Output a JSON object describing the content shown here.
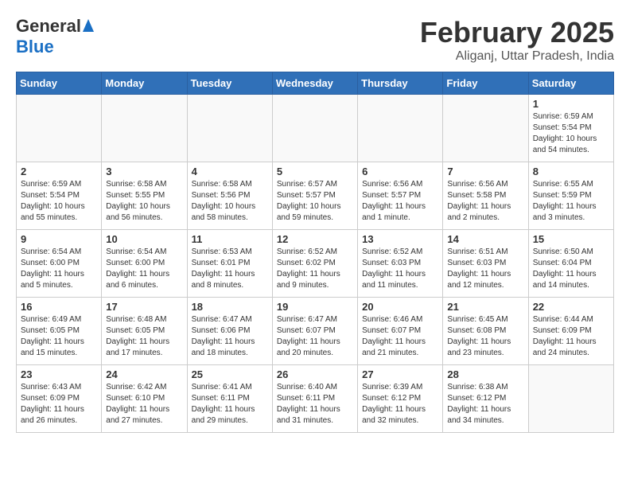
{
  "header": {
    "logo_general": "General",
    "logo_blue": "Blue",
    "month_title": "February 2025",
    "location": "Aliganj, Uttar Pradesh, India"
  },
  "weekdays": [
    "Sunday",
    "Monday",
    "Tuesday",
    "Wednesday",
    "Thursday",
    "Friday",
    "Saturday"
  ],
  "weeks": [
    [
      {
        "day": "",
        "info": ""
      },
      {
        "day": "",
        "info": ""
      },
      {
        "day": "",
        "info": ""
      },
      {
        "day": "",
        "info": ""
      },
      {
        "day": "",
        "info": ""
      },
      {
        "day": "",
        "info": ""
      },
      {
        "day": "1",
        "info": "Sunrise: 6:59 AM\nSunset: 5:54 PM\nDaylight: 10 hours and 54 minutes."
      }
    ],
    [
      {
        "day": "2",
        "info": "Sunrise: 6:59 AM\nSunset: 5:54 PM\nDaylight: 10 hours and 55 minutes."
      },
      {
        "day": "3",
        "info": "Sunrise: 6:58 AM\nSunset: 5:55 PM\nDaylight: 10 hours and 56 minutes."
      },
      {
        "day": "4",
        "info": "Sunrise: 6:58 AM\nSunset: 5:56 PM\nDaylight: 10 hours and 58 minutes."
      },
      {
        "day": "5",
        "info": "Sunrise: 6:57 AM\nSunset: 5:57 PM\nDaylight: 10 hours and 59 minutes."
      },
      {
        "day": "6",
        "info": "Sunrise: 6:56 AM\nSunset: 5:57 PM\nDaylight: 11 hours and 1 minute."
      },
      {
        "day": "7",
        "info": "Sunrise: 6:56 AM\nSunset: 5:58 PM\nDaylight: 11 hours and 2 minutes."
      },
      {
        "day": "8",
        "info": "Sunrise: 6:55 AM\nSunset: 5:59 PM\nDaylight: 11 hours and 3 minutes."
      }
    ],
    [
      {
        "day": "9",
        "info": "Sunrise: 6:54 AM\nSunset: 6:00 PM\nDaylight: 11 hours and 5 minutes."
      },
      {
        "day": "10",
        "info": "Sunrise: 6:54 AM\nSunset: 6:00 PM\nDaylight: 11 hours and 6 minutes."
      },
      {
        "day": "11",
        "info": "Sunrise: 6:53 AM\nSunset: 6:01 PM\nDaylight: 11 hours and 8 minutes."
      },
      {
        "day": "12",
        "info": "Sunrise: 6:52 AM\nSunset: 6:02 PM\nDaylight: 11 hours and 9 minutes."
      },
      {
        "day": "13",
        "info": "Sunrise: 6:52 AM\nSunset: 6:03 PM\nDaylight: 11 hours and 11 minutes."
      },
      {
        "day": "14",
        "info": "Sunrise: 6:51 AM\nSunset: 6:03 PM\nDaylight: 11 hours and 12 minutes."
      },
      {
        "day": "15",
        "info": "Sunrise: 6:50 AM\nSunset: 6:04 PM\nDaylight: 11 hours and 14 minutes."
      }
    ],
    [
      {
        "day": "16",
        "info": "Sunrise: 6:49 AM\nSunset: 6:05 PM\nDaylight: 11 hours and 15 minutes."
      },
      {
        "day": "17",
        "info": "Sunrise: 6:48 AM\nSunset: 6:05 PM\nDaylight: 11 hours and 17 minutes."
      },
      {
        "day": "18",
        "info": "Sunrise: 6:47 AM\nSunset: 6:06 PM\nDaylight: 11 hours and 18 minutes."
      },
      {
        "day": "19",
        "info": "Sunrise: 6:47 AM\nSunset: 6:07 PM\nDaylight: 11 hours and 20 minutes."
      },
      {
        "day": "20",
        "info": "Sunrise: 6:46 AM\nSunset: 6:07 PM\nDaylight: 11 hours and 21 minutes."
      },
      {
        "day": "21",
        "info": "Sunrise: 6:45 AM\nSunset: 6:08 PM\nDaylight: 11 hours and 23 minutes."
      },
      {
        "day": "22",
        "info": "Sunrise: 6:44 AM\nSunset: 6:09 PM\nDaylight: 11 hours and 24 minutes."
      }
    ],
    [
      {
        "day": "23",
        "info": "Sunrise: 6:43 AM\nSunset: 6:09 PM\nDaylight: 11 hours and 26 minutes."
      },
      {
        "day": "24",
        "info": "Sunrise: 6:42 AM\nSunset: 6:10 PM\nDaylight: 11 hours and 27 minutes."
      },
      {
        "day": "25",
        "info": "Sunrise: 6:41 AM\nSunset: 6:11 PM\nDaylight: 11 hours and 29 minutes."
      },
      {
        "day": "26",
        "info": "Sunrise: 6:40 AM\nSunset: 6:11 PM\nDaylight: 11 hours and 31 minutes."
      },
      {
        "day": "27",
        "info": "Sunrise: 6:39 AM\nSunset: 6:12 PM\nDaylight: 11 hours and 32 minutes."
      },
      {
        "day": "28",
        "info": "Sunrise: 6:38 AM\nSunset: 6:12 PM\nDaylight: 11 hours and 34 minutes."
      },
      {
        "day": "",
        "info": ""
      }
    ]
  ]
}
